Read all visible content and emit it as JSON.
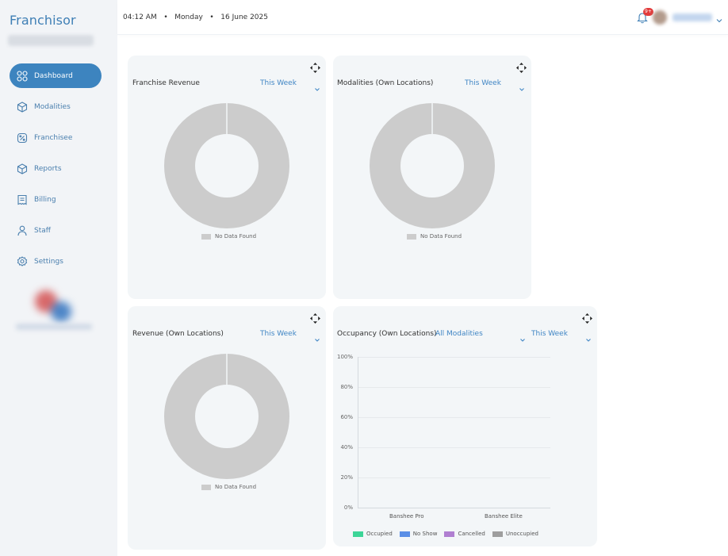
{
  "app": {
    "brand": "Franchisor"
  },
  "header": {
    "time": "04:12 AM",
    "day": "Monday",
    "date": "16 June 2025",
    "notification_count": "9+"
  },
  "sidebar": {
    "items": [
      {
        "label": "Dashboard",
        "icon": "dashboard-icon",
        "active": true
      },
      {
        "label": "Modalities",
        "icon": "box-icon"
      },
      {
        "label": "Franchisee",
        "icon": "discount-icon"
      },
      {
        "label": "Reports",
        "icon": "box-icon"
      },
      {
        "label": "Billing",
        "icon": "receipt-icon"
      },
      {
        "label": "Staff",
        "icon": "person-icon"
      },
      {
        "label": "Settings",
        "icon": "gear-icon"
      }
    ]
  },
  "cards": {
    "franchise_revenue": {
      "title": "Franchise Revenue",
      "period": "This Week",
      "legend": "No Data Found"
    },
    "modalities": {
      "title": "Modalities (Own Locations)",
      "period": "This Week",
      "legend": "No Data Found"
    },
    "revenue": {
      "title": "Revenue (Own Locations)",
      "period": "This Week",
      "legend": "No Data Found"
    },
    "occupancy": {
      "title": "Occupancy (Own Locations)",
      "filter": "All Modalities",
      "period": "This Week"
    }
  },
  "colors": {
    "accent": "#3d84bf",
    "donut_empty": "#cccccc",
    "occupied": "#3dd598",
    "no_show": "#5b8fe6",
    "cancelled": "#b07fd1",
    "unoccupied": "#9e9e9e"
  },
  "chart_data": [
    {
      "type": "pie",
      "title": "Franchise Revenue",
      "labels": [
        "No Data Found"
      ],
      "values": [
        100
      ]
    },
    {
      "type": "pie",
      "title": "Modalities (Own Locations)",
      "labels": [
        "No Data Found"
      ],
      "values": [
        100
      ]
    },
    {
      "type": "pie",
      "title": "Revenue (Own Locations)",
      "labels": [
        "No Data Found"
      ],
      "values": [
        100
      ]
    },
    {
      "type": "bar",
      "title": "Occupancy (Own Locations)",
      "categories": [
        "Banshee Pro",
        "Banshee Elite"
      ],
      "series": [
        {
          "name": "Occupied",
          "values": [
            0,
            0
          ]
        },
        {
          "name": "No Show",
          "values": [
            0,
            0
          ]
        },
        {
          "name": "Cancelled",
          "values": [
            0,
            0
          ]
        },
        {
          "name": "Unoccupied",
          "values": [
            0,
            0
          ]
        }
      ],
      "y_ticks": [
        "100%",
        "80%",
        "60%",
        "40%",
        "20%",
        "0%"
      ],
      "ylim": [
        0,
        100
      ],
      "legend": "bottom"
    }
  ]
}
